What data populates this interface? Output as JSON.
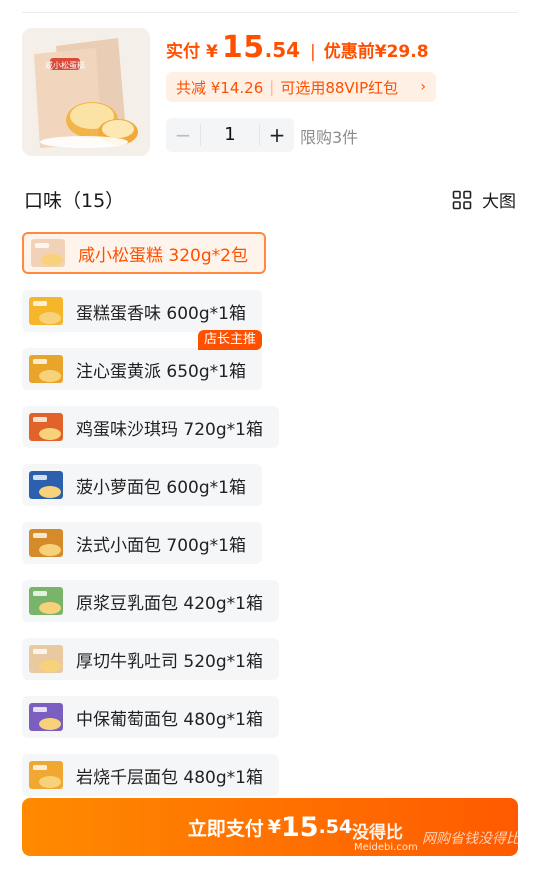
{
  "summary": {
    "pay_label": "实付",
    "pay_currency": "¥",
    "pay_amount": "15",
    "pay_cents": ".54",
    "separator": "|",
    "before_label": "优惠前",
    "before_price": "¥29.8",
    "discount_text": "共减 ¥14.26",
    "discount_sep": "|",
    "voucher_text": "可选用88VIP红包",
    "chevron": "›",
    "quantity": "1",
    "minus": "−",
    "plus": "+",
    "limit_text": "限购3件",
    "product_image_brand_text": "咸小松蛋糕"
  },
  "flavor_section": {
    "title": "口味（15）",
    "big_view_label": "大图"
  },
  "options": [
    {
      "label": "咸小松蛋糕 320g*2包",
      "selected": true,
      "badge": "",
      "thumb_color": "#f2d2b6"
    },
    {
      "label": "蛋糕蛋香味 600g*1箱",
      "selected": false,
      "badge": "",
      "thumb_color": "#f5b62b"
    },
    {
      "label": "注心蛋黄派 650g*1箱",
      "selected": false,
      "badge": "店长主推",
      "thumb_color": "#e9a42a"
    },
    {
      "label": "鸡蛋味沙琪玛 720g*1箱",
      "selected": false,
      "badge": "",
      "thumb_color": "#e0632a"
    },
    {
      "label": "菠小萝面包 600g*1箱",
      "selected": false,
      "badge": "",
      "thumb_color": "#2c5fae"
    },
    {
      "label": "法式小面包 700g*1箱",
      "selected": false,
      "badge": "",
      "thumb_color": "#d58b2a"
    },
    {
      "label": "原浆豆乳面包 420g*1箱",
      "selected": false,
      "badge": "",
      "thumb_color": "#7ab36a"
    },
    {
      "label": "厚切牛乳吐司 520g*1箱",
      "selected": false,
      "badge": "",
      "thumb_color": "#e8c9a0"
    },
    {
      "label": "中保葡萄面包 480g*1箱",
      "selected": false,
      "badge": "",
      "thumb_color": "#7a5fc0"
    },
    {
      "label": "岩烧千层面包 480g*1箱",
      "selected": false,
      "badge": "",
      "thumb_color": "#f0a832"
    }
  ],
  "pay_button": {
    "label": "立即支付",
    "currency": "¥",
    "amount": "15",
    "cents": ".54"
  },
  "watermark": {
    "brand": "没得比",
    "domain": "Meidebi.com",
    "slogan": "网购省钱没得比"
  },
  "colors": {
    "accent": "#ff5000",
    "selected_border": "#ff8a3d",
    "option_bg": "#f5f6f8"
  }
}
